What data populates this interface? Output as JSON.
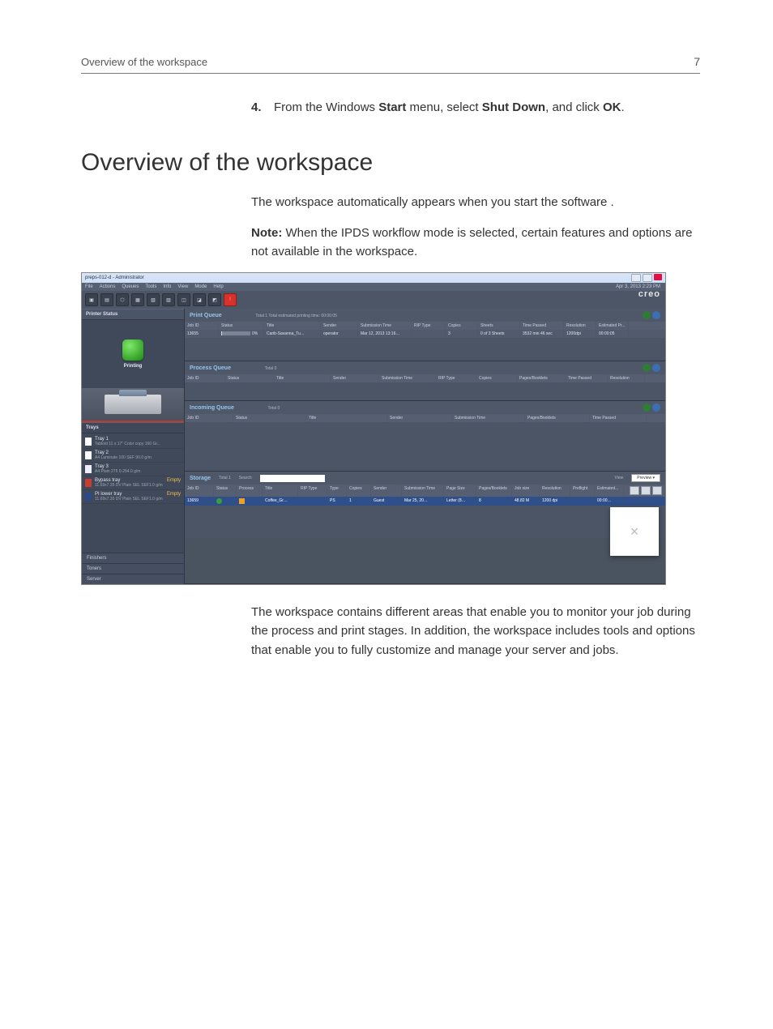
{
  "header": {
    "title": "Overview of the workspace",
    "pagenum": "7"
  },
  "step": {
    "num": "4.",
    "text_a": "From the Windows ",
    "bold_a": "Start",
    "text_b": " menu, select ",
    "bold_b": "Shut Down",
    "text_c": ", and click ",
    "bold_c": "OK",
    "text_d": "."
  },
  "heading": "Overview of the workspace",
  "intro": "The workspace automatically appears when you start the software .",
  "note_prefix": "Note:",
  "note_body": " When the IPDS workflow mode is selected, certain features and options are not available in the workspace.",
  "after": "The workspace contains different areas that enable you to monitor your job during the process and print stages. In addition, the workspace includes tools and options that enable you to fully customize and manage your server and jobs.",
  "screenshot": {
    "title": "preps-012-d - Administrator",
    "menus": [
      "File",
      "Actions",
      "Queues",
      "Tools",
      "Info",
      "View",
      "Mode",
      "Help"
    ],
    "date": "Apr 3, 2013 2:23 PM",
    "brand": "creo",
    "left": {
      "printer_status_title": "Printer Status",
      "printing_label": "Printing",
      "trays_title": "Trays",
      "trays": [
        {
          "swatch": "sw-white",
          "t1": "Tray 1",
          "t2": "Tabloid 11 x 17\" Color copy 160 Gr...",
          "flag": ""
        },
        {
          "swatch": "sw-white",
          "t1": "Tray 2",
          "t2": "A4 Laminate 100 SEF 90.0 g/m",
          "flag": ""
        },
        {
          "swatch": "sw-white2",
          "t1": "Tray 3",
          "t2": "A4 Plain 275 0-254.0 g/m",
          "flag": ""
        },
        {
          "swatch": "sw-red",
          "t1": "Bypass tray",
          "t2": "11.69x7.35 DV Plain SEL SEF1.0 g/m",
          "flag": "Empty"
        },
        {
          "swatch": "sw-blue",
          "t1": "PI lower tray",
          "t2": "11.69x7.35 DV Plain SEL SEF1.0 g/m",
          "flag": "Empty"
        }
      ],
      "collapsers": [
        "Finishers",
        "Toners",
        "Server"
      ]
    },
    "print_queue": {
      "title": "Print Queue",
      "meta": "Total 1    Total estimated printing time: 00:00:05",
      "cols": [
        "Job ID",
        "Status",
        "Title",
        "Sender",
        "Submission Time",
        "RIP Type",
        "Copies",
        "Sheets",
        "Time Passed",
        "Resolution",
        "Estimated Pr..."
      ],
      "row": {
        "job": "13655",
        "status": "0%",
        "title": "Carib-Savanna_Tu…",
        "sender": "operator",
        "sub": "Mar 12, 2013 13:16…",
        "rip": "",
        "copies": "3",
        "sheets": "0 of 3 Sheets",
        "passed": "3532 min 46 sec",
        "res": "1200dpi",
        "est": "00:00:05"
      }
    },
    "process_queue": {
      "title": "Process Queue",
      "meta": "Total 0",
      "cols": [
        "Job ID",
        "Status",
        "Title",
        "Sender",
        "Submission Time",
        "RIP Type",
        "Copies",
        "Pages/Booklets",
        "Time Passed",
        "Resolution"
      ]
    },
    "incoming_queue": {
      "title": "Incoming Queue",
      "meta": "Total 0",
      "cols": [
        "Job ID",
        "Status",
        "Title",
        "Sender",
        "Submission Time",
        "Pages/Booklets",
        "Time Passed"
      ]
    },
    "storage": {
      "title": "Storage",
      "meta": "Total 1",
      "search_label": "Search",
      "view_label": "View",
      "view_value": "Preview",
      "cols": [
        "Job ID",
        "Status",
        "Process",
        "Title",
        "RIP Type",
        "Type",
        "Copies",
        "Sender",
        "Submission Time",
        "Page Size",
        "Pages/Booklets",
        "Job size",
        "Resolution",
        "Preflight",
        "Estimated..."
      ],
      "row": {
        "job": "13659",
        "title": "Coffee_Gr…",
        "type": "PS",
        "copies": "1",
        "sender": "Guest",
        "sub": "Mar 25, 20…",
        "pagesize": "Letter (8…",
        "pb": "8",
        "jobsize": "48.82 M",
        "res": "1200 dpi",
        "pre": "",
        "est": "00:00…"
      }
    },
    "preview_close": "×"
  }
}
